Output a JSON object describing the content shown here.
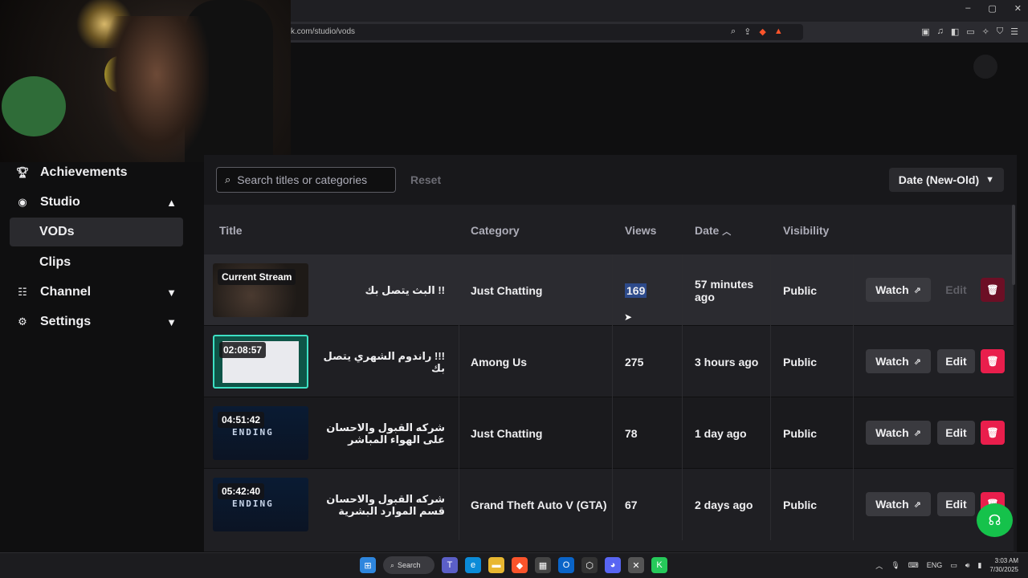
{
  "browser": {
    "url": "k.com/studio/vods",
    "window_controls": [
      "–",
      "▢",
      "✕"
    ]
  },
  "sidebar": {
    "items": [
      {
        "label": "Achievements",
        "icon": "trophy-icon"
      },
      {
        "label": "Studio",
        "icon": "studio-icon",
        "expanded": true
      },
      {
        "label": "VODs",
        "active": true
      },
      {
        "label": "Clips"
      },
      {
        "label": "Channel",
        "icon": "channel-icon",
        "expanded": false
      },
      {
        "label": "Settings",
        "icon": "gear-icon",
        "expanded": false
      }
    ]
  },
  "toolbar": {
    "search_placeholder": "Search titles or categories",
    "reset_label": "Reset",
    "sort_label": "Date (New-Old)"
  },
  "table": {
    "headers": {
      "title": "Title",
      "category": "Category",
      "views": "Views",
      "date": "Date",
      "visibility": "Visibility"
    },
    "rows": [
      {
        "badge": "Current Stream",
        "title": "!! البث يتصل بك",
        "category": "Just Chatting",
        "views": "169",
        "date": "57 minutes ago",
        "visibility": "Public",
        "watch": "Watch",
        "edit": "Edit"
      },
      {
        "badge": "02:08:57",
        "title": "!!! راندوم الشهري يتصل بك",
        "category": "Among Us",
        "views": "275",
        "date": "3 hours ago",
        "visibility": "Public",
        "watch": "Watch",
        "edit": "Edit"
      },
      {
        "badge": "04:51:42",
        "title": "شركه القبول والاحسان على الهواء المباشر",
        "category": "Just Chatting",
        "views": "78",
        "date": "1 day ago",
        "visibility": "Public",
        "watch": "Watch",
        "edit": "Edit"
      },
      {
        "badge": "05:42:40",
        "title": "شركه القبول والاحسان قسم الموارد البشرية",
        "category": "Grand Theft Auto V (GTA)",
        "views": "67",
        "date": "2 days ago",
        "visibility": "Public",
        "watch": "Watch",
        "edit": "Edit"
      }
    ],
    "thumb_text": "ENDING"
  },
  "taskbar": {
    "search_label": "Search",
    "lang": "ENG",
    "time": "3:03 AM",
    "date": "7/30/2025"
  },
  "colors": {
    "delete": "#e91e4c",
    "support": "#15c24b",
    "accent_highlight": "#2d4a8a"
  }
}
